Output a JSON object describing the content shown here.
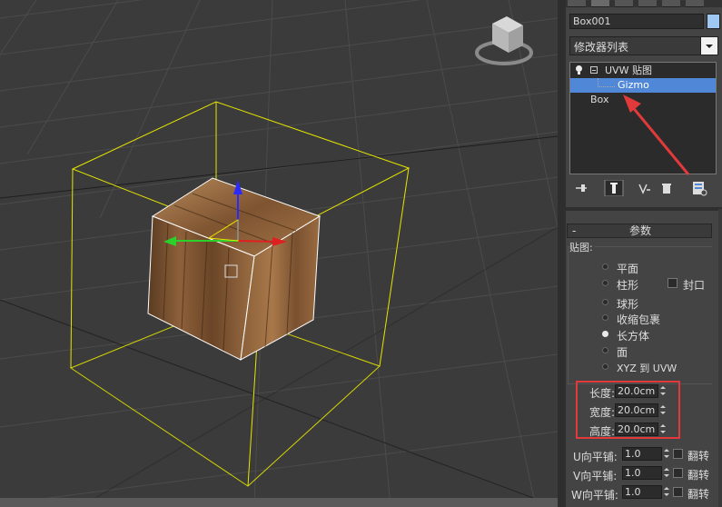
{
  "object_name": "Box001",
  "object_color": "#9fc8f5",
  "modifier_list_label": "修改器列表",
  "modifier_stack": [
    {
      "label": "UVW 贴图",
      "level": 0,
      "selected": false
    },
    {
      "label": "Gizmo",
      "level": 1,
      "selected": true
    },
    {
      "label": "Box",
      "level": 0,
      "selected": false
    }
  ],
  "rollout": {
    "title": "参数",
    "collapse_symbol": "-",
    "mapping_group_label": "贴图:",
    "mapping_options": [
      {
        "label": "平面",
        "checked": false
      },
      {
        "label": "柱形",
        "checked": false
      },
      {
        "label": "球形",
        "checked": false
      },
      {
        "label": "收缩包裹",
        "checked": false
      },
      {
        "label": "长方体",
        "checked": true
      },
      {
        "label": "面",
        "checked": false
      },
      {
        "label": "XYZ 到 UVW",
        "checked": false
      }
    ],
    "cap_label": "封口",
    "dimensions": [
      {
        "label": "长度:",
        "value": "20.0cm"
      },
      {
        "label": "宽度:",
        "value": "20.0cm"
      },
      {
        "label": "高度:",
        "value": "20.0cm"
      }
    ],
    "tiling": [
      {
        "label": "U向平铺:",
        "value": "1.0",
        "flip_label": "翻转"
      },
      {
        "label": "V向平铺:",
        "value": "1.0",
        "flip_label": "翻转"
      },
      {
        "label": "W向平铺:",
        "value": "1.0",
        "flip_label": "翻转"
      }
    ]
  },
  "colors": {
    "selection_blue": "#5087d6",
    "gizmo_yellow": "#e6e600",
    "annotation_red": "#e23a3a"
  },
  "icons": [
    "viewcube-icon",
    "pin-stack-icon",
    "show-end-result-icon",
    "make-unique-icon",
    "remove-modifier-icon",
    "configure-sets-icon",
    "light-bulb-icon"
  ]
}
